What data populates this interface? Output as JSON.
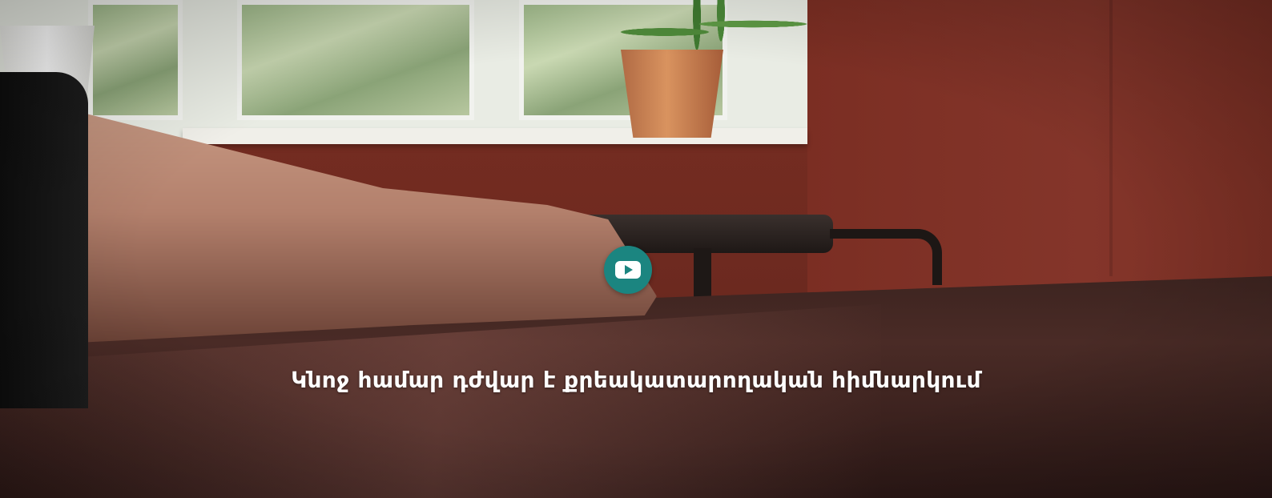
{
  "hero": {
    "caption": "Կնոջ համար դժվար է քրեակատարողական հիմնարկում",
    "play_button": {
      "icon": "play-icon",
      "color": "#1b8580"
    }
  }
}
